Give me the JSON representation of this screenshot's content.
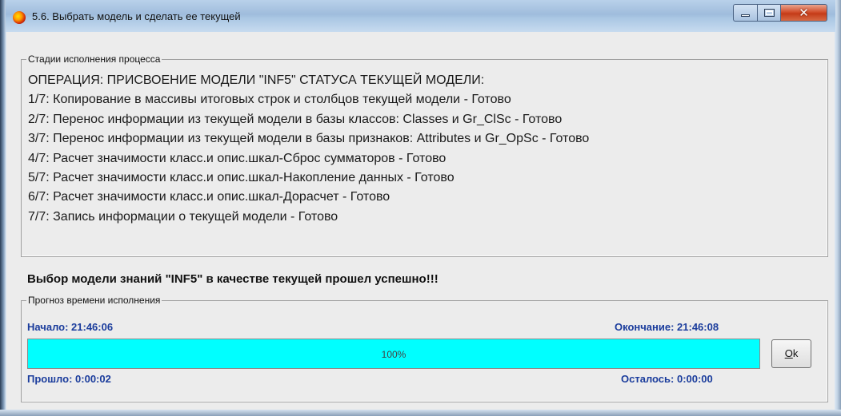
{
  "window": {
    "title": "5.6. Выбрать модель и сделать ее текущей",
    "icon": "app-icon",
    "controls": [
      "minimize-icon",
      "maximize-icon",
      "close-icon"
    ]
  },
  "stages_group": {
    "legend": "Стадии исполнения процесса",
    "lines": [
      "ОПЕРАЦИЯ: ПРИСВОЕНИЕ МОДЕЛИ \"INF5\" СТАТУСА ТЕКУЩЕЙ МОДЕЛИ:",
      "1/7: Копирование в массивы итоговых строк и столбцов текущей модели - Готово",
      "2/7: Перенос информации из текущей модели в базы классов:   Classes    и Gr_ClSc - Готово",
      "3/7: Перенос информации из текущей модели в базы признаков: Attributes и Gr_OpSc - Готово",
      "4/7: Расчет значимости класс.и опис.шкал-Сброс сумматоров - Готово",
      "5/7: Расчет значимости класс.и опис.шкал-Накопление данных - Готово",
      "6/7: Расчет значимости класс.и опис.шкал-Дорасчет - Готово",
      "7/7: Запись информации о текущей модели - Готово"
    ]
  },
  "success_message": "Выбор модели знаний \"INF5\" в качестве текущей прошел успешно!!!",
  "forecast_group": {
    "legend": "Прогноз времени исполнения",
    "start_label": "Начало: 21:46:06",
    "end_label": "Окончание: 21:46:08",
    "elapsed_label": "Прошло: 0:00:02",
    "remaining_label": "Осталось: 0:00:00",
    "progress_percent": 100,
    "progress_text": "100%",
    "progress_color": "#00ffff"
  },
  "ok_button": {
    "mnemonic": "O",
    "rest": "k"
  }
}
